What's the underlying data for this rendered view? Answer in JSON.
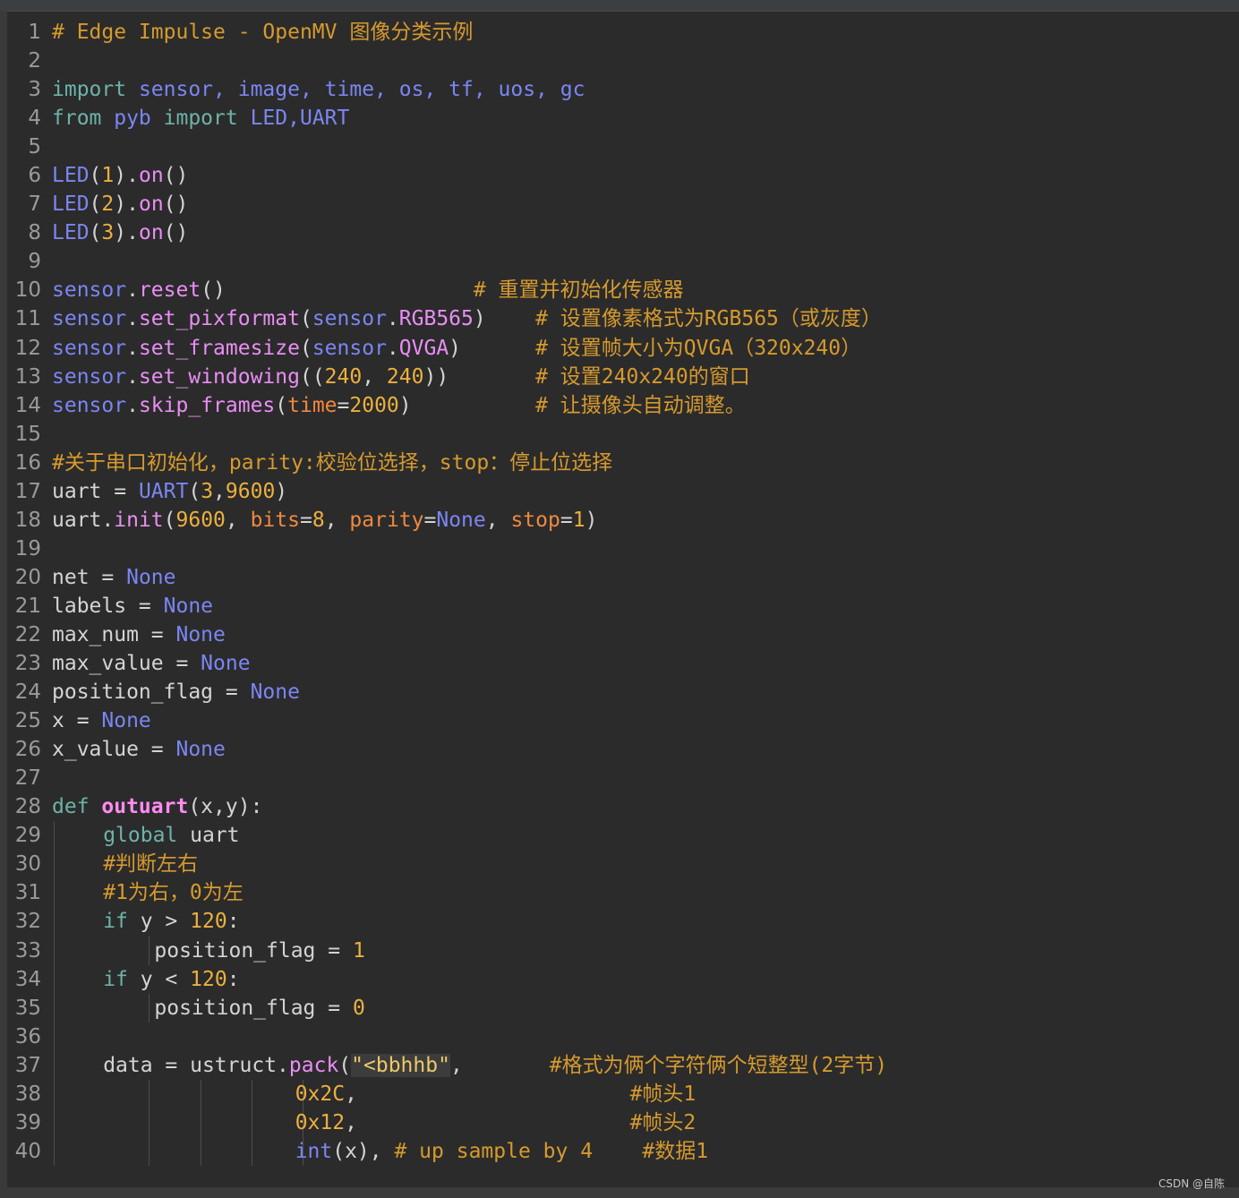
{
  "editor": {
    "lines": [
      {
        "n": "1",
        "indent": 0,
        "tokens": [
          {
            "t": "# Edge Impulse - OpenMV 图像分类示例",
            "c": "co"
          }
        ]
      },
      {
        "n": "2",
        "indent": 0,
        "tokens": []
      },
      {
        "n": "3",
        "indent": 0,
        "tokens": [
          {
            "t": "import",
            "c": "kw"
          },
          {
            "t": " sensor, image, time, os, tf, uos, gc",
            "c": "bi"
          }
        ]
      },
      {
        "n": "4",
        "indent": 0,
        "tokens": [
          {
            "t": "from",
            "c": "kw"
          },
          {
            "t": " pyb ",
            "c": "bi"
          },
          {
            "t": "import",
            "c": "kw"
          },
          {
            "t": " LED,UART",
            "c": "bi"
          }
        ]
      },
      {
        "n": "5",
        "indent": 0,
        "tokens": []
      },
      {
        "n": "6",
        "indent": 0,
        "tokens": [
          {
            "t": "LED",
            "c": "bi"
          },
          {
            "t": "(",
            "c": "op"
          },
          {
            "t": "1",
            "c": "nm"
          },
          {
            "t": ").",
            "c": "op"
          },
          {
            "t": "on",
            "c": "fn"
          },
          {
            "t": "()",
            "c": "op"
          }
        ]
      },
      {
        "n": "7",
        "indent": 0,
        "tokens": [
          {
            "t": "LED",
            "c": "bi"
          },
          {
            "t": "(",
            "c": "op"
          },
          {
            "t": "2",
            "c": "nm"
          },
          {
            "t": ").",
            "c": "op"
          },
          {
            "t": "on",
            "c": "fn"
          },
          {
            "t": "()",
            "c": "op"
          }
        ]
      },
      {
        "n": "8",
        "indent": 0,
        "tokens": [
          {
            "t": "LED",
            "c": "bi"
          },
          {
            "t": "(",
            "c": "op"
          },
          {
            "t": "3",
            "c": "nm"
          },
          {
            "t": ").",
            "c": "op"
          },
          {
            "t": "on",
            "c": "fn"
          },
          {
            "t": "()",
            "c": "op"
          }
        ]
      },
      {
        "n": "9",
        "indent": 0,
        "tokens": []
      },
      {
        "n": "10",
        "indent": 0,
        "tokens": [
          {
            "t": "sensor",
            "c": "bi"
          },
          {
            "t": ".",
            "c": "op"
          },
          {
            "t": "reset",
            "c": "fn"
          },
          {
            "t": "()                    ",
            "c": "op"
          },
          {
            "t": "# 重置并初始化传感器",
            "c": "co"
          }
        ]
      },
      {
        "n": "11",
        "indent": 0,
        "tokens": [
          {
            "t": "sensor",
            "c": "bi"
          },
          {
            "t": ".",
            "c": "op"
          },
          {
            "t": "set_pixformat",
            "c": "fn"
          },
          {
            "t": "(",
            "c": "op"
          },
          {
            "t": "sensor",
            "c": "bi"
          },
          {
            "t": ".",
            "c": "op"
          },
          {
            "t": "RGB565",
            "c": "fn"
          },
          {
            "t": ")    ",
            "c": "op"
          },
          {
            "t": "# 设置像素格式为RGB565（或灰度）",
            "c": "co"
          }
        ]
      },
      {
        "n": "12",
        "indent": 0,
        "tokens": [
          {
            "t": "sensor",
            "c": "bi"
          },
          {
            "t": ".",
            "c": "op"
          },
          {
            "t": "set_framesize",
            "c": "fn"
          },
          {
            "t": "(",
            "c": "op"
          },
          {
            "t": "sensor",
            "c": "bi"
          },
          {
            "t": ".",
            "c": "op"
          },
          {
            "t": "QVGA",
            "c": "fn"
          },
          {
            "t": ")      ",
            "c": "op"
          },
          {
            "t": "# 设置帧大小为QVGA（320x240）",
            "c": "co"
          }
        ]
      },
      {
        "n": "13",
        "indent": 0,
        "tokens": [
          {
            "t": "sensor",
            "c": "bi"
          },
          {
            "t": ".",
            "c": "op"
          },
          {
            "t": "set_windowing",
            "c": "fn"
          },
          {
            "t": "((",
            "c": "op"
          },
          {
            "t": "240",
            "c": "nm"
          },
          {
            "t": ", ",
            "c": "op"
          },
          {
            "t": "240",
            "c": "nm"
          },
          {
            "t": "))       ",
            "c": "op"
          },
          {
            "t": "# 设置240x240的窗口",
            "c": "co"
          }
        ]
      },
      {
        "n": "14",
        "indent": 0,
        "tokens": [
          {
            "t": "sensor",
            "c": "bi"
          },
          {
            "t": ".",
            "c": "op"
          },
          {
            "t": "skip_frames",
            "c": "fn"
          },
          {
            "t": "(",
            "c": "op"
          },
          {
            "t": "time",
            "c": "pa"
          },
          {
            "t": "=",
            "c": "op"
          },
          {
            "t": "2000",
            "c": "nm"
          },
          {
            "t": ")          ",
            "c": "op"
          },
          {
            "t": "# 让摄像头自动调整。",
            "c": "co"
          }
        ]
      },
      {
        "n": "15",
        "indent": 0,
        "tokens": []
      },
      {
        "n": "16",
        "indent": 0,
        "tokens": [
          {
            "t": "#关于串口初始化，parity:校验位选择，stop：停止位选择",
            "c": "co"
          }
        ]
      },
      {
        "n": "17",
        "indent": 0,
        "tokens": [
          {
            "t": "uart = ",
            "c": "op"
          },
          {
            "t": "UART",
            "c": "bi"
          },
          {
            "t": "(",
            "c": "op"
          },
          {
            "t": "3",
            "c": "nm"
          },
          {
            "t": ",",
            "c": "op"
          },
          {
            "t": "9600",
            "c": "nm"
          },
          {
            "t": ")",
            "c": "op"
          }
        ]
      },
      {
        "n": "18",
        "indent": 0,
        "tokens": [
          {
            "t": "uart.",
            "c": "op"
          },
          {
            "t": "init",
            "c": "fn"
          },
          {
            "t": "(",
            "c": "op"
          },
          {
            "t": "9600",
            "c": "nm"
          },
          {
            "t": ", ",
            "c": "op"
          },
          {
            "t": "bits",
            "c": "pa"
          },
          {
            "t": "=",
            "c": "op"
          },
          {
            "t": "8",
            "c": "nm"
          },
          {
            "t": ", ",
            "c": "op"
          },
          {
            "t": "parity",
            "c": "pa"
          },
          {
            "t": "=",
            "c": "op"
          },
          {
            "t": "None",
            "c": "bi"
          },
          {
            "t": ", ",
            "c": "op"
          },
          {
            "t": "stop",
            "c": "pa"
          },
          {
            "t": "=",
            "c": "op"
          },
          {
            "t": "1",
            "c": "nm"
          },
          {
            "t": ")",
            "c": "op"
          }
        ]
      },
      {
        "n": "19",
        "indent": 0,
        "tokens": []
      },
      {
        "n": "20",
        "indent": 0,
        "tokens": [
          {
            "t": "net = ",
            "c": "op"
          },
          {
            "t": "None",
            "c": "bi"
          }
        ]
      },
      {
        "n": "21",
        "indent": 0,
        "tokens": [
          {
            "t": "labels = ",
            "c": "op"
          },
          {
            "t": "None",
            "c": "bi"
          }
        ]
      },
      {
        "n": "22",
        "indent": 0,
        "tokens": [
          {
            "t": "max_num = ",
            "c": "op"
          },
          {
            "t": "None",
            "c": "bi"
          }
        ]
      },
      {
        "n": "23",
        "indent": 0,
        "tokens": [
          {
            "t": "max_value = ",
            "c": "op"
          },
          {
            "t": "None",
            "c": "bi"
          }
        ]
      },
      {
        "n": "24",
        "indent": 0,
        "tokens": [
          {
            "t": "position_flag = ",
            "c": "op"
          },
          {
            "t": "None",
            "c": "bi"
          }
        ]
      },
      {
        "n": "25",
        "indent": 0,
        "tokens": [
          {
            "t": "x = ",
            "c": "op"
          },
          {
            "t": "None",
            "c": "bi"
          }
        ]
      },
      {
        "n": "26",
        "indent": 0,
        "tokens": [
          {
            "t": "x_value = ",
            "c": "op"
          },
          {
            "t": "None",
            "c": "bi"
          }
        ]
      },
      {
        "n": "27",
        "indent": 0,
        "tokens": []
      },
      {
        "n": "28",
        "indent": 0,
        "tokens": [
          {
            "t": "def ",
            "c": "kw"
          },
          {
            "t": "outuart",
            "c": "fndef"
          },
          {
            "t": "(x,y):",
            "c": "op"
          }
        ]
      },
      {
        "n": "29",
        "indent": 1,
        "tokens": [
          {
            "t": "global",
            "c": "kw"
          },
          {
            "t": " uart",
            "c": "op"
          }
        ]
      },
      {
        "n": "30",
        "indent": 1,
        "tokens": [
          {
            "t": "#判断左右",
            "c": "co"
          }
        ]
      },
      {
        "n": "31",
        "indent": 1,
        "tokens": [
          {
            "t": "#1为右，0为左",
            "c": "co"
          }
        ]
      },
      {
        "n": "32",
        "indent": 1,
        "tokens": [
          {
            "t": "if",
            "c": "kw"
          },
          {
            "t": " y > ",
            "c": "op"
          },
          {
            "t": "120",
            "c": "nm"
          },
          {
            "t": ":",
            "c": "op"
          }
        ]
      },
      {
        "n": "33",
        "indent": 2,
        "tokens": [
          {
            "t": "position_flag = ",
            "c": "op"
          },
          {
            "t": "1",
            "c": "nm"
          }
        ]
      },
      {
        "n": "34",
        "indent": 1,
        "tokens": [
          {
            "t": "if",
            "c": "kw"
          },
          {
            "t": " y < ",
            "c": "op"
          },
          {
            "t": "120",
            "c": "nm"
          },
          {
            "t": ":",
            "c": "op"
          }
        ]
      },
      {
        "n": "35",
        "indent": 2,
        "tokens": [
          {
            "t": "position_flag = ",
            "c": "op"
          },
          {
            "t": "0",
            "c": "nm"
          }
        ]
      },
      {
        "n": "36",
        "indent": 1,
        "tokens": []
      },
      {
        "n": "37",
        "indent": 1,
        "tokens": [
          {
            "t": "data = ustruct.",
            "c": "op"
          },
          {
            "t": "pack",
            "c": "fn"
          },
          {
            "t": "(",
            "c": "op"
          },
          {
            "t": "\"<bbhhb\"",
            "c": "st"
          },
          {
            "t": ",       ",
            "c": "op"
          },
          {
            "t": "#格式为俩个字符俩个短整型(2字节)",
            "c": "co"
          }
        ]
      },
      {
        "n": "38",
        "indent": 5,
        "tokens": [
          {
            "t": "0x2C",
            "c": "nm"
          },
          {
            "t": ",                      ",
            "c": "op"
          },
          {
            "t": "#帧头1",
            "c": "co"
          }
        ]
      },
      {
        "n": "39",
        "indent": 5,
        "tokens": [
          {
            "t": "0x12",
            "c": "nm"
          },
          {
            "t": ",                      ",
            "c": "op"
          },
          {
            "t": "#帧头2",
            "c": "co"
          }
        ]
      },
      {
        "n": "40",
        "indent": 5,
        "tokens": [
          {
            "t": "int",
            "c": "bi"
          },
          {
            "t": "(x), ",
            "c": "op"
          },
          {
            "t": "# up sample by 4    #数据1",
            "c": "co"
          }
        ]
      }
    ]
  },
  "watermark": "CSDN @自陈"
}
